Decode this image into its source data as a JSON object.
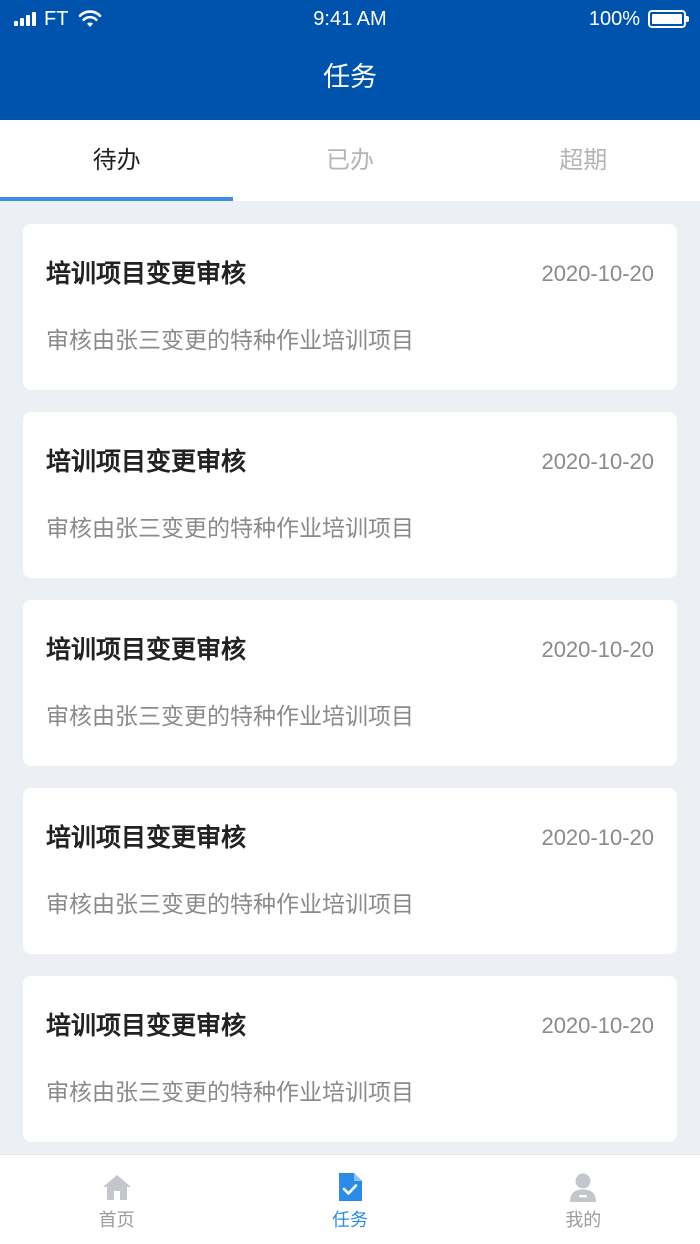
{
  "status_bar": {
    "carrier": "FT",
    "time": "9:41 AM",
    "battery": "100%"
  },
  "header": {
    "title": "任务"
  },
  "tabs": [
    {
      "label": "待办",
      "active": true
    },
    {
      "label": "已办",
      "active": false
    },
    {
      "label": "超期",
      "active": false
    }
  ],
  "tasks": [
    {
      "title": "培训项目变更审核",
      "date": "2020-10-20",
      "description": "审核由张三变更的特种作业培训项目"
    },
    {
      "title": "培训项目变更审核",
      "date": "2020-10-20",
      "description": "审核由张三变更的特种作业培训项目"
    },
    {
      "title": "培训项目变更审核",
      "date": "2020-10-20",
      "description": "审核由张三变更的特种作业培训项目"
    },
    {
      "title": "培训项目变更审核",
      "date": "2020-10-20",
      "description": "审核由张三变更的特种作业培训项目"
    },
    {
      "title": "培训项目变更审核",
      "date": "2020-10-20",
      "description": "审核由张三变更的特种作业培训项目"
    }
  ],
  "bottom_nav": [
    {
      "label": "首页",
      "icon": "home-icon",
      "active": false
    },
    {
      "label": "任务",
      "icon": "task-document-icon",
      "active": true
    },
    {
      "label": "我的",
      "icon": "user-icon",
      "active": false
    }
  ],
  "colors": {
    "header_bg": "#0053ac",
    "accent": "#2b8be6",
    "tab_underline": "#3a8ee6",
    "page_bg": "#eceff3",
    "inactive": "#9b9b9b"
  }
}
